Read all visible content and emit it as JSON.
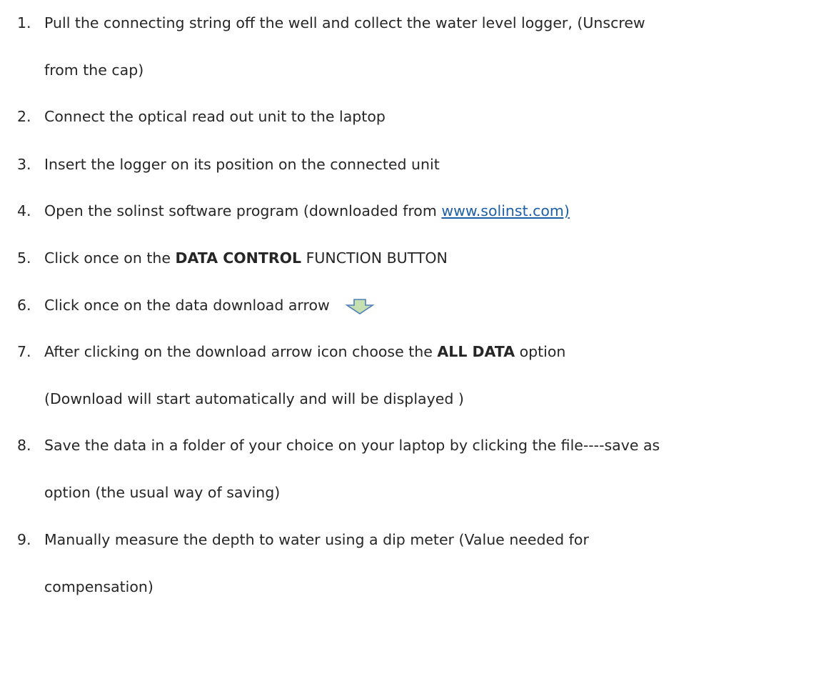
{
  "steps": [
    {
      "number": "1.",
      "line1": "Pull the connecting string off the well and collect the water level logger, (Unscrew",
      "line2": "from the cap)"
    },
    {
      "number": "2.",
      "text": "Connect the optical read out unit to the laptop"
    },
    {
      "number": "3.",
      "text": "Insert the logger on its position on the connected unit"
    },
    {
      "number": "4.",
      "text_before": "Open the solinst software program (downloaded from ",
      "link": "www.solinst.com)"
    },
    {
      "number": "5.",
      "text_before": "Click once on the ",
      "bold": "DATA CONTROL",
      "text_after": " FUNCTION BUTTON"
    },
    {
      "number": "6.",
      "text": "Click once on the data download arrow",
      "icon": "download-arrow-icon"
    },
    {
      "number": "7.",
      "text_before": "After clicking  on the download arrow icon choose the ",
      "bold": "ALL DATA",
      "text_after": " option",
      "line2": "(Download will start automatically and will be displayed )"
    },
    {
      "number": "8.",
      "line1": "Save the data in a folder of your choice on your laptop  by clicking the file----save as",
      "line2": "option (the usual way of saving)"
    },
    {
      "number": "9.",
      "line1": "Manually measure the depth to water using a dip meter (Value needed for",
      "line2": "compensation)"
    }
  ],
  "colors": {
    "text": "#262626",
    "link": "#1f5fa8",
    "arrow_fill": "#c6dfb2",
    "arrow_stroke": "#4f7fb8"
  }
}
